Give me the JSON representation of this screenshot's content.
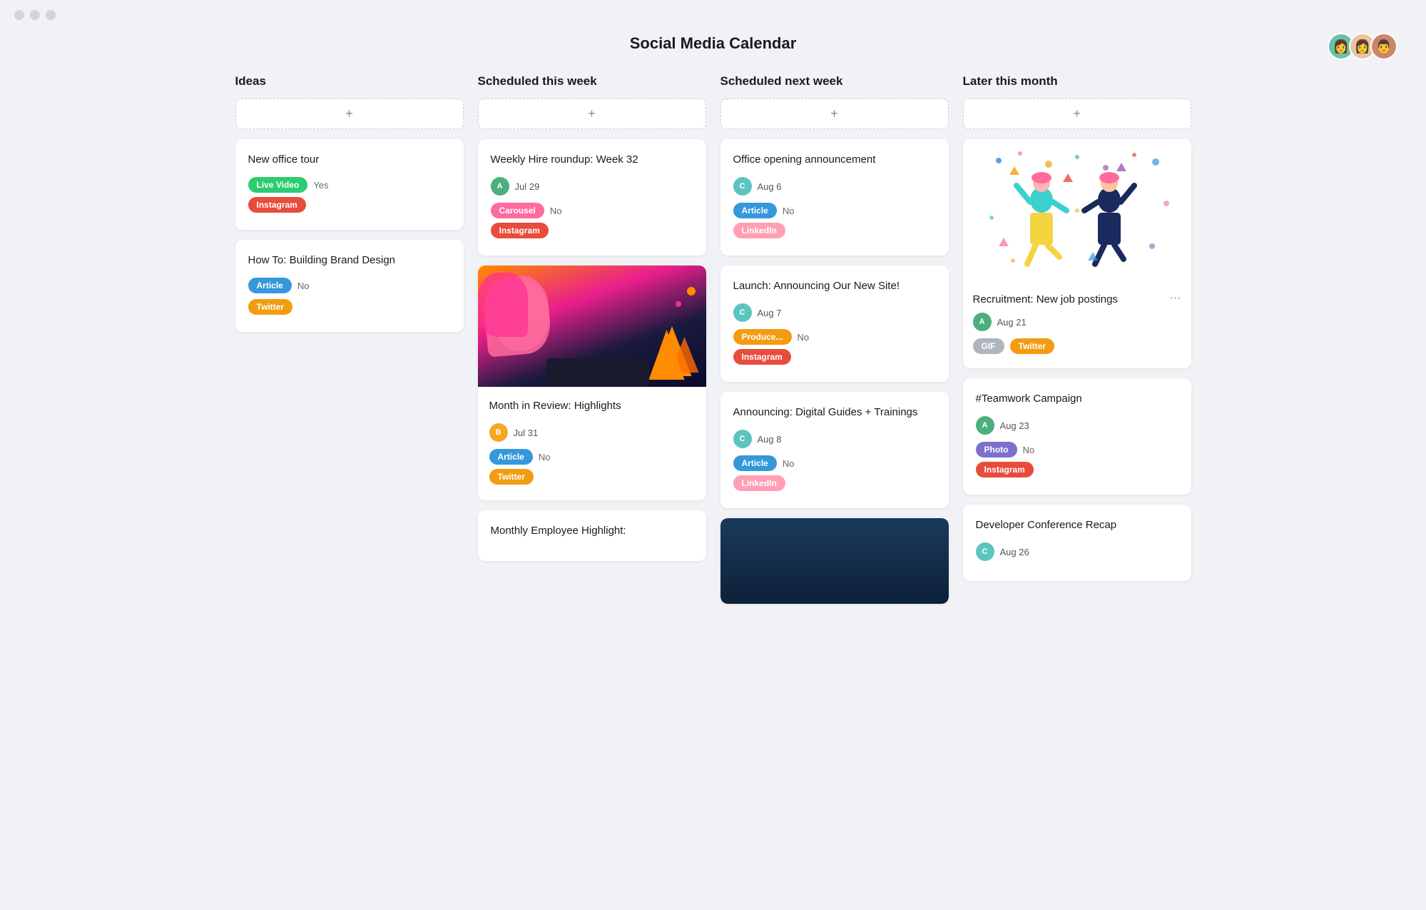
{
  "app": {
    "title": "Social Media Calendar"
  },
  "columns": [
    {
      "id": "ideas",
      "label": "Ideas",
      "cards": [
        {
          "id": "card-1",
          "title": "New office tour",
          "tags": [
            {
              "label": "Live Video",
              "class": "tag-live-video"
            },
            {
              "label": "Instagram",
              "class": "tag-instagram"
            }
          ],
          "statusLabel": "Yes",
          "hasImage": false
        },
        {
          "id": "card-2",
          "title": "How To: Building Brand Design",
          "tags": [
            {
              "label": "Article",
              "class": "tag-article"
            },
            {
              "label": "Twitter",
              "class": "tag-twitter"
            }
          ],
          "statusLabel": "No",
          "hasImage": false
        }
      ]
    },
    {
      "id": "scheduled-this-week",
      "label": "Scheduled this week",
      "cards": [
        {
          "id": "card-3",
          "title": "Weekly Hire roundup: Week 32",
          "date": "Jul 29",
          "avatarClass": "ua-green",
          "avatarInitial": "A",
          "tags": [
            {
              "label": "Carousel",
              "class": "tag-carousel"
            },
            {
              "label": "Instagram",
              "class": "tag-instagram"
            }
          ],
          "statusLabel": "No",
          "hasImage": false
        },
        {
          "id": "card-4",
          "title": "Month in Review: Highlights",
          "date": "Jul 31",
          "avatarClass": "ua-orange",
          "avatarInitial": "B",
          "tags": [
            {
              "label": "Article",
              "class": "tag-article"
            },
            {
              "label": "Twitter",
              "class": "tag-twitter"
            }
          ],
          "statusLabel": "No",
          "hasImage": true,
          "imageType": "graphic"
        },
        {
          "id": "card-5",
          "title": "Monthly Employee Highlight:",
          "hasImage": false,
          "partial": true
        }
      ]
    },
    {
      "id": "scheduled-next-week",
      "label": "Scheduled next week",
      "cards": [
        {
          "id": "card-6",
          "title": "Office opening announcement",
          "date": "Aug 6",
          "avatarClass": "ua-teal",
          "avatarInitial": "C",
          "tags": [
            {
              "label": "Article",
              "class": "tag-article"
            },
            {
              "label": "LinkedIn",
              "class": "tag-linkedin"
            }
          ],
          "statusLabel": "No",
          "hasImage": false
        },
        {
          "id": "card-7",
          "title": "Launch: Announcing Our New Site!",
          "date": "Aug 7",
          "avatarClass": "ua-teal",
          "avatarInitial": "C",
          "tags": [
            {
              "label": "Produce...",
              "class": "tag-produce"
            },
            {
              "label": "Instagram",
              "class": "tag-instagram"
            }
          ],
          "statusLabel": "No",
          "hasImage": false
        },
        {
          "id": "card-8",
          "title": "Announcing: Digital Guides + Trainings",
          "date": "Aug 8",
          "avatarClass": "ua-teal",
          "avatarInitial": "C",
          "tags": [
            {
              "label": "Article",
              "class": "tag-article"
            },
            {
              "label": "LinkedIn",
              "class": "tag-linkedin"
            }
          ],
          "statusLabel": "No",
          "hasImage": false
        }
      ]
    },
    {
      "id": "later-this-month",
      "label": "Later this month",
      "cards": [
        {
          "id": "card-9",
          "title": "Recruitment: New job postings",
          "date": "Aug 21",
          "avatarClass": "ua-green",
          "avatarInitial": "A",
          "tags": [
            {
              "label": "GIF",
              "class": "tag-gif"
            },
            {
              "label": "Twitter",
              "class": "tag-twitter"
            }
          ],
          "hasImage": true,
          "imageType": "celebration",
          "hasDots": true
        },
        {
          "id": "card-10",
          "title": "#Teamwork Campaign",
          "date": "Aug 23",
          "avatarClass": "ua-green",
          "avatarInitial": "A",
          "tags": [
            {
              "label": "Photo",
              "class": "tag-photo"
            },
            {
              "label": "Instagram",
              "class": "tag-instagram"
            }
          ],
          "statusLabel": "No",
          "hasImage": false
        },
        {
          "id": "card-11",
          "title": "Developer Conference Recap",
          "date": "Aug 26",
          "avatarClass": "ua-teal",
          "avatarInitial": "C",
          "hasImage": false,
          "partial": true
        }
      ]
    }
  ],
  "buttons": {
    "add": "+"
  }
}
